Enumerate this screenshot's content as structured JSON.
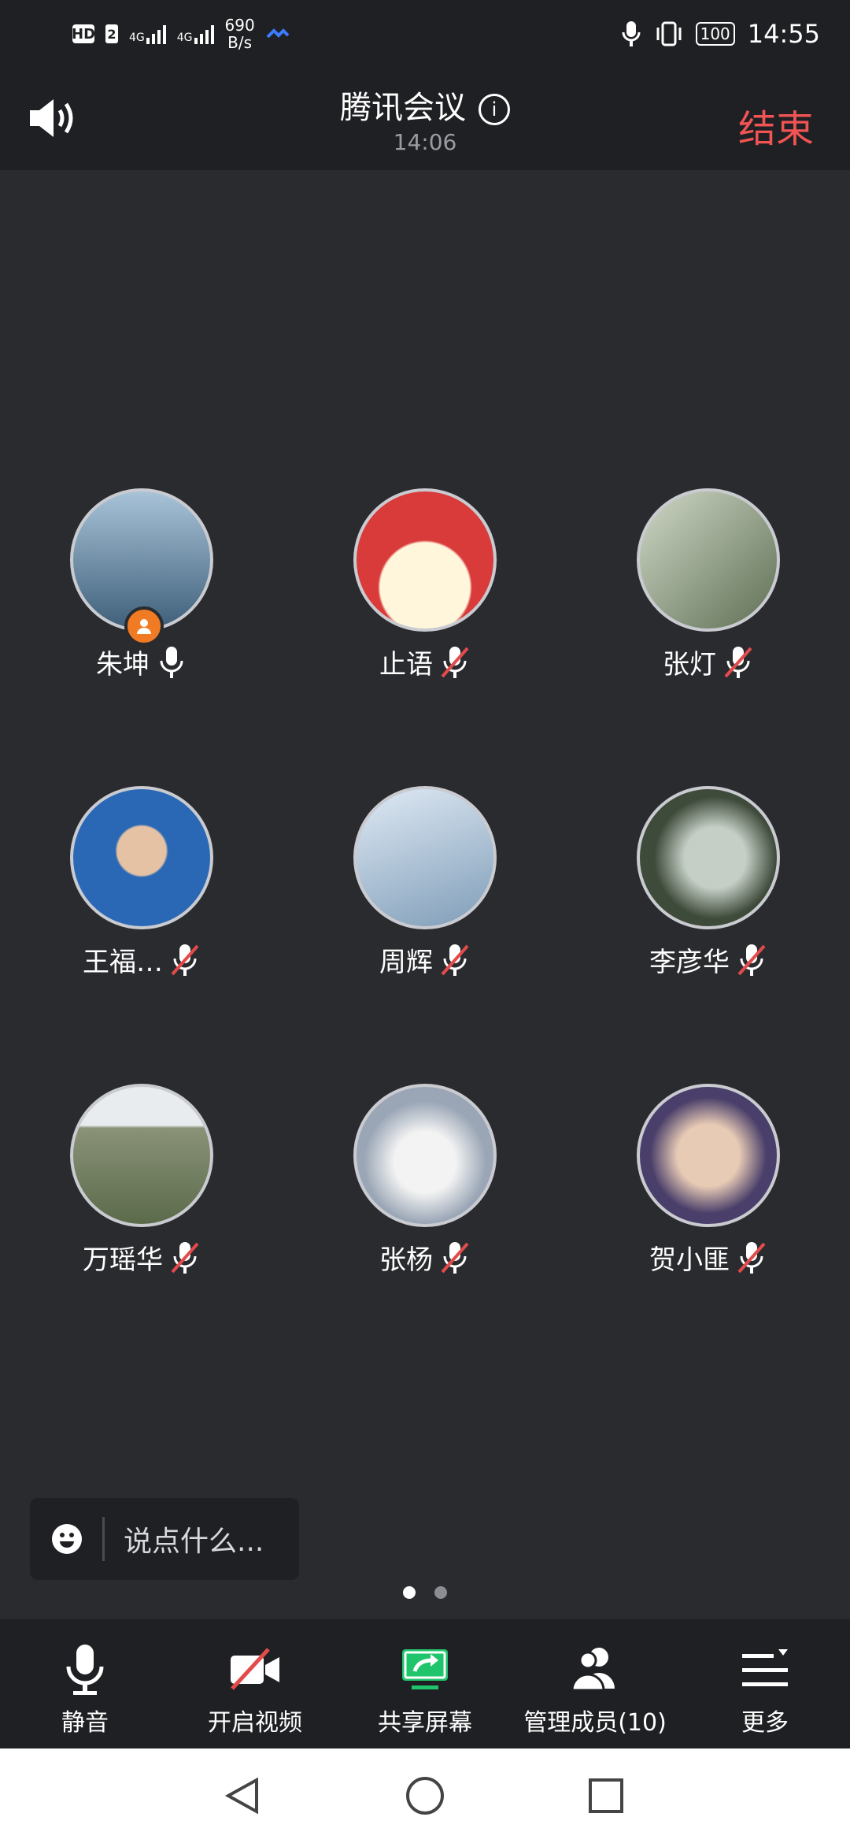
{
  "status_bar": {
    "hd": "HD",
    "sim": "2",
    "net1": "4G",
    "net2": "4G",
    "rate_value": "690",
    "rate_unit": "B/s",
    "battery": "100",
    "clock": "14:55",
    "icons": [
      "mic-icon",
      "vibrate-icon",
      "battery-icon",
      "signal-icon"
    ]
  },
  "header": {
    "title": "腾讯会议",
    "elapsed": "14:06",
    "end_label": "结束",
    "speaker_icon": "speaker-icon",
    "info_icon": "info-icon"
  },
  "participants": [
    {
      "name": "朱坤",
      "mic": "on",
      "host": true,
      "avatar_color": "#6f8aa3"
    },
    {
      "name": "止语",
      "mic": "muted",
      "host": false,
      "avatar_color": "#d93a3a"
    },
    {
      "name": "张灯",
      "mic": "muted",
      "host": false,
      "avatar_color": "#7d8a6c"
    },
    {
      "name": "王福…",
      "mic": "muted",
      "host": false,
      "avatar_color": "#2a68b5"
    },
    {
      "name": "周辉",
      "mic": "muted",
      "host": false,
      "avatar_color": "#9fb6cf"
    },
    {
      "name": "李彦华",
      "mic": "muted",
      "host": false,
      "avatar_color": "#4e5a4a"
    },
    {
      "name": "万瑶华",
      "mic": "muted",
      "host": false,
      "avatar_color": "#7b8572"
    },
    {
      "name": "张杨",
      "mic": "muted",
      "host": false,
      "avatar_color": "#b9c1ce"
    },
    {
      "name": "贺小匪",
      "mic": "muted",
      "host": false,
      "avatar_color": "#5a4f7c"
    }
  ],
  "chat": {
    "placeholder": "说点什么..."
  },
  "pagination": {
    "current": 1,
    "total": 2
  },
  "toolbar": [
    {
      "label": "静音",
      "icon": "mic-icon"
    },
    {
      "label": "开启视频",
      "icon": "video-off-icon"
    },
    {
      "label": "共享屏幕",
      "icon": "share-screen-icon"
    },
    {
      "label": "管理成员(10)",
      "icon": "members-icon"
    },
    {
      "label": "更多",
      "icon": "more-menu-icon"
    }
  ],
  "colors": {
    "accent_red": "#f05454",
    "share_green": "#1fc46b",
    "host_orange": "#f07b23"
  }
}
